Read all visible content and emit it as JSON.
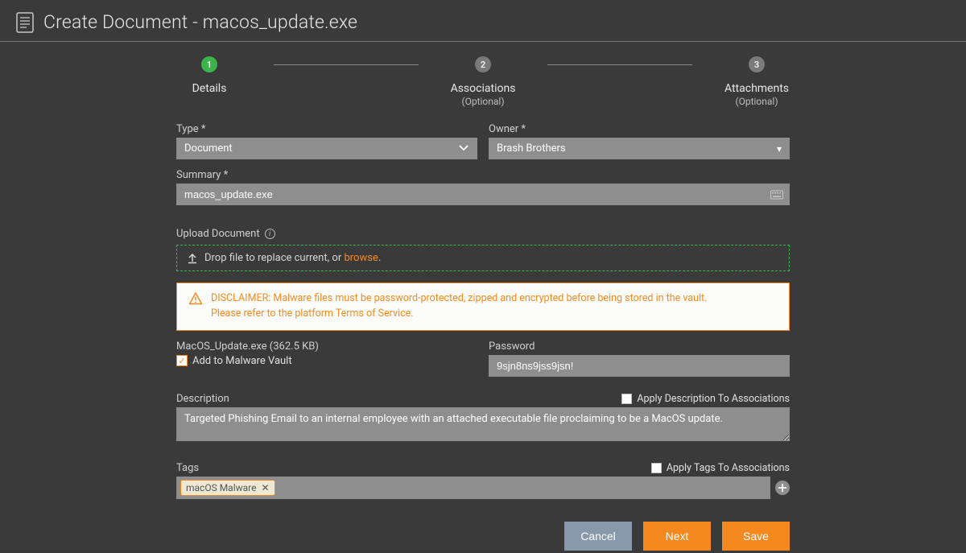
{
  "header": {
    "title": "Create Document - macos_update.exe"
  },
  "stepper": {
    "steps": [
      {
        "num": "1",
        "label": "Details",
        "sub": ""
      },
      {
        "num": "2",
        "label": "Associations",
        "sub": "(Optional)"
      },
      {
        "num": "3",
        "label": "Attachments",
        "sub": "(Optional)"
      }
    ]
  },
  "fields": {
    "type_label": "Type *",
    "type_value": "Document",
    "owner_label": "Owner *",
    "owner_value": "Brash Brothers",
    "summary_label": "Summary *",
    "summary_value": "macos_update.exe",
    "upload_label": "Upload Document",
    "dropzone_prefix": "Drop file to replace current, or ",
    "dropzone_link": "browse",
    "dropzone_suffix": ".",
    "disclaimer_line1": "DISCLAIMER: Malware files must be password-protected, zipped and encrypted before being stored in the vault.",
    "disclaimer_line2": "Please refer to the platform Terms of Service.",
    "file_name": "MacOS_Update.exe (362.5 KB)",
    "add_vault_label": "Add to Malware Vault",
    "password_label": "Password",
    "password_value": "9sjn8ns9jss9jsn!",
    "description_label": "Description",
    "apply_desc_label": "Apply Description To Associations",
    "description_value": "Targeted Phishing Email to an internal employee with an attached executable file proclaiming to be a MacOS update.",
    "tags_label": "Tags",
    "apply_tags_label": "Apply Tags To Associations",
    "tag_value": "macOS Malware"
  },
  "buttons": {
    "cancel": "Cancel",
    "next": "Next",
    "save": "Save"
  }
}
